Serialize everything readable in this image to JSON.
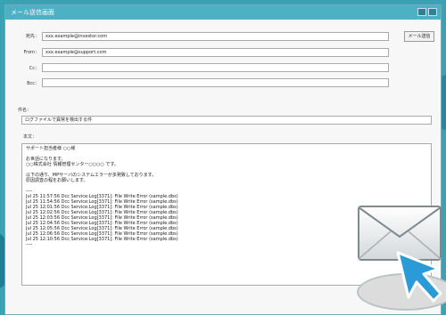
{
  "window": {
    "title": "メール送信画面"
  },
  "form": {
    "to_label": "宛先：",
    "to_value": "xxx.example@investor.com",
    "from_label": "From：",
    "from_value": "xxx.example@support.com",
    "cc_label": "Cc：",
    "cc_value": "",
    "bcc_label": "Bcc：",
    "bcc_value": "",
    "subject_label": "件名：",
    "subject_value": "ログファイルで異常を検出する件",
    "body_label": "本文："
  },
  "send_button": "メール送信",
  "body_lines": [
    "サポート担当者様 ○○様",
    "",
    "お世話になります。",
    "○○株式会社 情報管理センター○○○○ です。",
    "",
    "以下の通り、MPサーバのシステムエラーが多発致しております。",
    "原因調査の程をお願いします。",
    "",
    "----",
    "Jul 25 11:57:56 Dcc Service:Log[3371]: File Write Error (sample.dbs)",
    "Jul 25 11:54:56 Dcc Service:Log[3371]: File Write Error (sample.dbs)",
    "Jul 25 12:01:56 Dcc Service:Log[3371]: File Write Error (sample.dbs)",
    "Jul 25 12:02:56 Dcc Service:Log[3371]: File Write Error (sample.dbs)",
    "Jul 25 12:03:56 Dcc Service:Log[3371]: File Write Error (sample.dbs)",
    "Jul 25 12:04:56 Dcc Service:Log[3371]: File Write Error (sample.dbs)",
    "Jul 25 12:05:56 Dcc Service:Log[3371]: File Write Error (sample.dbs)",
    "Jul 25 12:06:56 Dcc Service:Log[3371]: File Write Error (sample.dbs)",
    "Jul 25 12:10:56 Dcc Service:Log[3371]: File Write Error (sample.dbs)",
    "----"
  ],
  "icons": {
    "window_controls": [
      "minimize-icon",
      "close-icon"
    ],
    "mail": "envelope-icon",
    "pointer": "arrow-cursor-icon"
  },
  "colors": {
    "background": "#3aa3b3",
    "titlebar": "#4eb0c3",
    "cursor_blue": "#2a9bd6"
  }
}
